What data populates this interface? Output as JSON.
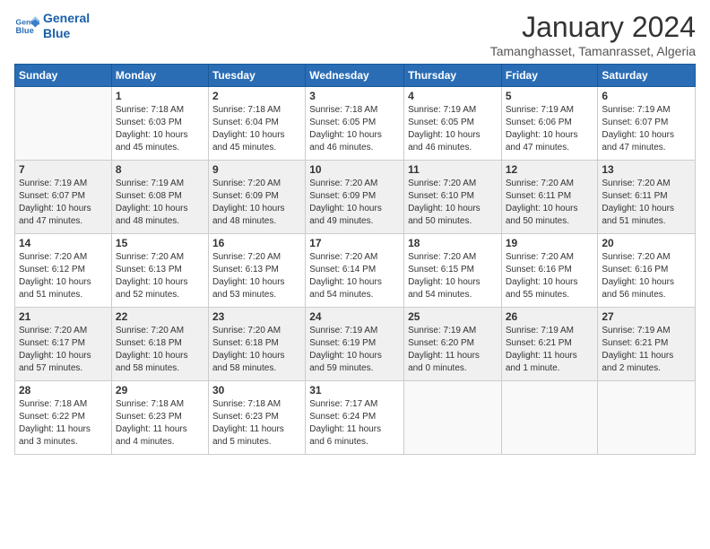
{
  "header": {
    "logo_line1": "General",
    "logo_line2": "Blue",
    "month_title": "January 2024",
    "location": "Tamanghasset, Tamanrasset, Algeria"
  },
  "weekdays": [
    "Sunday",
    "Monday",
    "Tuesday",
    "Wednesday",
    "Thursday",
    "Friday",
    "Saturday"
  ],
  "weeks": [
    [
      {
        "day": "",
        "info": ""
      },
      {
        "day": "1",
        "info": "Sunrise: 7:18 AM\nSunset: 6:03 PM\nDaylight: 10 hours\nand 45 minutes."
      },
      {
        "day": "2",
        "info": "Sunrise: 7:18 AM\nSunset: 6:04 PM\nDaylight: 10 hours\nand 45 minutes."
      },
      {
        "day": "3",
        "info": "Sunrise: 7:18 AM\nSunset: 6:05 PM\nDaylight: 10 hours\nand 46 minutes."
      },
      {
        "day": "4",
        "info": "Sunrise: 7:19 AM\nSunset: 6:05 PM\nDaylight: 10 hours\nand 46 minutes."
      },
      {
        "day": "5",
        "info": "Sunrise: 7:19 AM\nSunset: 6:06 PM\nDaylight: 10 hours\nand 47 minutes."
      },
      {
        "day": "6",
        "info": "Sunrise: 7:19 AM\nSunset: 6:07 PM\nDaylight: 10 hours\nand 47 minutes."
      }
    ],
    [
      {
        "day": "7",
        "info": "Sunrise: 7:19 AM\nSunset: 6:07 PM\nDaylight: 10 hours\nand 47 minutes."
      },
      {
        "day": "8",
        "info": "Sunrise: 7:19 AM\nSunset: 6:08 PM\nDaylight: 10 hours\nand 48 minutes."
      },
      {
        "day": "9",
        "info": "Sunrise: 7:20 AM\nSunset: 6:09 PM\nDaylight: 10 hours\nand 48 minutes."
      },
      {
        "day": "10",
        "info": "Sunrise: 7:20 AM\nSunset: 6:09 PM\nDaylight: 10 hours\nand 49 minutes."
      },
      {
        "day": "11",
        "info": "Sunrise: 7:20 AM\nSunset: 6:10 PM\nDaylight: 10 hours\nand 50 minutes."
      },
      {
        "day": "12",
        "info": "Sunrise: 7:20 AM\nSunset: 6:11 PM\nDaylight: 10 hours\nand 50 minutes."
      },
      {
        "day": "13",
        "info": "Sunrise: 7:20 AM\nSunset: 6:11 PM\nDaylight: 10 hours\nand 51 minutes."
      }
    ],
    [
      {
        "day": "14",
        "info": "Sunrise: 7:20 AM\nSunset: 6:12 PM\nDaylight: 10 hours\nand 51 minutes."
      },
      {
        "day": "15",
        "info": "Sunrise: 7:20 AM\nSunset: 6:13 PM\nDaylight: 10 hours\nand 52 minutes."
      },
      {
        "day": "16",
        "info": "Sunrise: 7:20 AM\nSunset: 6:13 PM\nDaylight: 10 hours\nand 53 minutes."
      },
      {
        "day": "17",
        "info": "Sunrise: 7:20 AM\nSunset: 6:14 PM\nDaylight: 10 hours\nand 54 minutes."
      },
      {
        "day": "18",
        "info": "Sunrise: 7:20 AM\nSunset: 6:15 PM\nDaylight: 10 hours\nand 54 minutes."
      },
      {
        "day": "19",
        "info": "Sunrise: 7:20 AM\nSunset: 6:16 PM\nDaylight: 10 hours\nand 55 minutes."
      },
      {
        "day": "20",
        "info": "Sunrise: 7:20 AM\nSunset: 6:16 PM\nDaylight: 10 hours\nand 56 minutes."
      }
    ],
    [
      {
        "day": "21",
        "info": "Sunrise: 7:20 AM\nSunset: 6:17 PM\nDaylight: 10 hours\nand 57 minutes."
      },
      {
        "day": "22",
        "info": "Sunrise: 7:20 AM\nSunset: 6:18 PM\nDaylight: 10 hours\nand 58 minutes."
      },
      {
        "day": "23",
        "info": "Sunrise: 7:20 AM\nSunset: 6:18 PM\nDaylight: 10 hours\nand 58 minutes."
      },
      {
        "day": "24",
        "info": "Sunrise: 7:19 AM\nSunset: 6:19 PM\nDaylight: 10 hours\nand 59 minutes."
      },
      {
        "day": "25",
        "info": "Sunrise: 7:19 AM\nSunset: 6:20 PM\nDaylight: 11 hours\nand 0 minutes."
      },
      {
        "day": "26",
        "info": "Sunrise: 7:19 AM\nSunset: 6:21 PM\nDaylight: 11 hours\nand 1 minute."
      },
      {
        "day": "27",
        "info": "Sunrise: 7:19 AM\nSunset: 6:21 PM\nDaylight: 11 hours\nand 2 minutes."
      }
    ],
    [
      {
        "day": "28",
        "info": "Sunrise: 7:18 AM\nSunset: 6:22 PM\nDaylight: 11 hours\nand 3 minutes."
      },
      {
        "day": "29",
        "info": "Sunrise: 7:18 AM\nSunset: 6:23 PM\nDaylight: 11 hours\nand 4 minutes."
      },
      {
        "day": "30",
        "info": "Sunrise: 7:18 AM\nSunset: 6:23 PM\nDaylight: 11 hours\nand 5 minutes."
      },
      {
        "day": "31",
        "info": "Sunrise: 7:17 AM\nSunset: 6:24 PM\nDaylight: 11 hours\nand 6 minutes."
      },
      {
        "day": "",
        "info": ""
      },
      {
        "day": "",
        "info": ""
      },
      {
        "day": "",
        "info": ""
      }
    ]
  ]
}
